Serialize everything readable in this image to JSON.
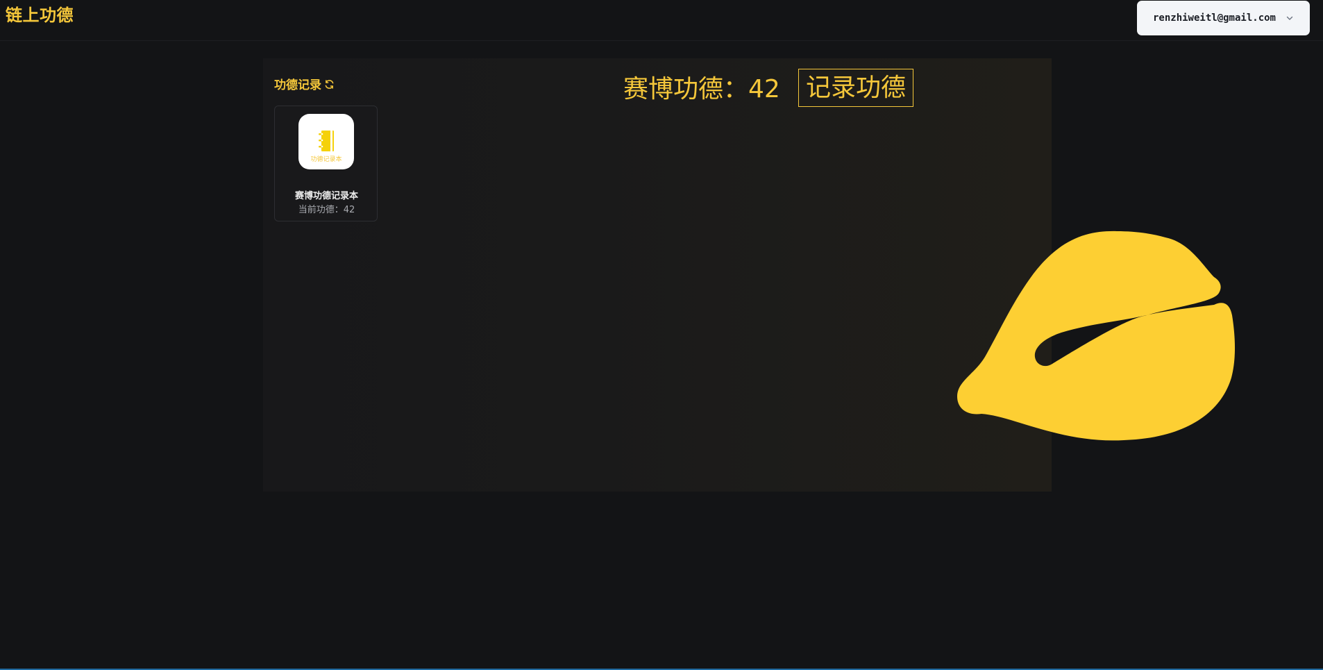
{
  "header": {
    "brand": "链上功德",
    "account_email": "renzhiweitl@gmail.com"
  },
  "sidebar": {
    "title": "功德记录",
    "cards": [
      {
        "icon_label": "功德记录本",
        "name": "赛博功德记录本",
        "merit": "当前功德：42"
      }
    ]
  },
  "main": {
    "counter": "赛博功德：42",
    "record_button": "记录功德",
    "woodfish_color": "#fdcf33"
  },
  "colors": {
    "accent": "#f5c73a",
    "background": "#131416"
  }
}
